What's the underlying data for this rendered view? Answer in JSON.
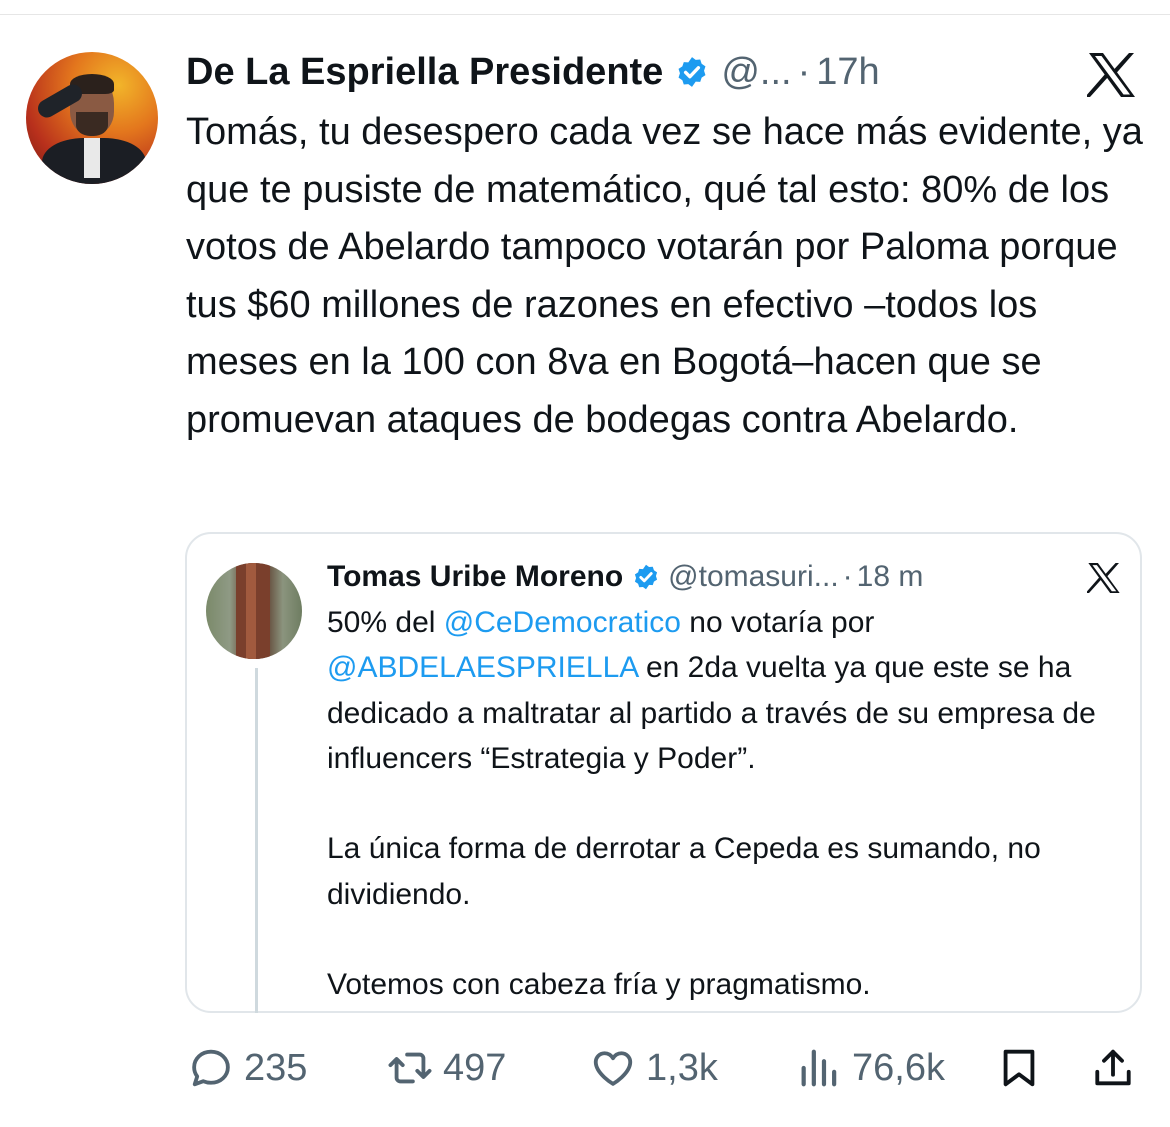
{
  "tweet": {
    "author_name": "De La Espriella Presidente",
    "handle": "@...",
    "separator": "·",
    "time": "17h",
    "text": "Tomás, tu desespero cada vez se hace más evidente, ya que te pusiste de matemático, qué tal esto: 80% de los votos de Abelardo tampoco votarán por Paloma porque tus $60 millones de razones en efectivo –todos los meses en la 100 con 8va en Bogotá–hacen que se promuevan ataques de bodegas contra Abelardo."
  },
  "quoted": {
    "author_name": "Tomas Uribe Moreno",
    "handle": "@tomasuri...",
    "separator": "·",
    "time": "18 m",
    "p1_start": "50% del ",
    "p1_mention1": "@CeDemocratico",
    "p1_mid": " no votaría por ",
    "p1_mention2": "@ABDELAESPRIELLA",
    "p1_end": " en 2da vuelta ya que este se ha dedicado a maltratar al partido a través de su empresa de influencers “Estrategia y Poder”.",
    "p2": "La única forma de derrotar a Cepeda es sumando, no dividiendo.",
    "p3": "Votemos con cabeza fría y pragmatismo."
  },
  "actions": {
    "replies": "235",
    "reposts": "497",
    "likes": "1,3k",
    "views": "76,6k"
  },
  "icons": {
    "verified": "verified-badge-icon",
    "x_logo": "x-logo-icon",
    "reply": "reply-icon",
    "repost": "repost-icon",
    "like": "heart-icon",
    "views": "views-icon",
    "bookmark": "bookmark-icon",
    "share": "share-icon"
  },
  "colors": {
    "text": "#0f1419",
    "secondary": "#536471",
    "link": "#1d9bf0",
    "verified": "#1d9bf0",
    "border": "#e1e6ea"
  }
}
